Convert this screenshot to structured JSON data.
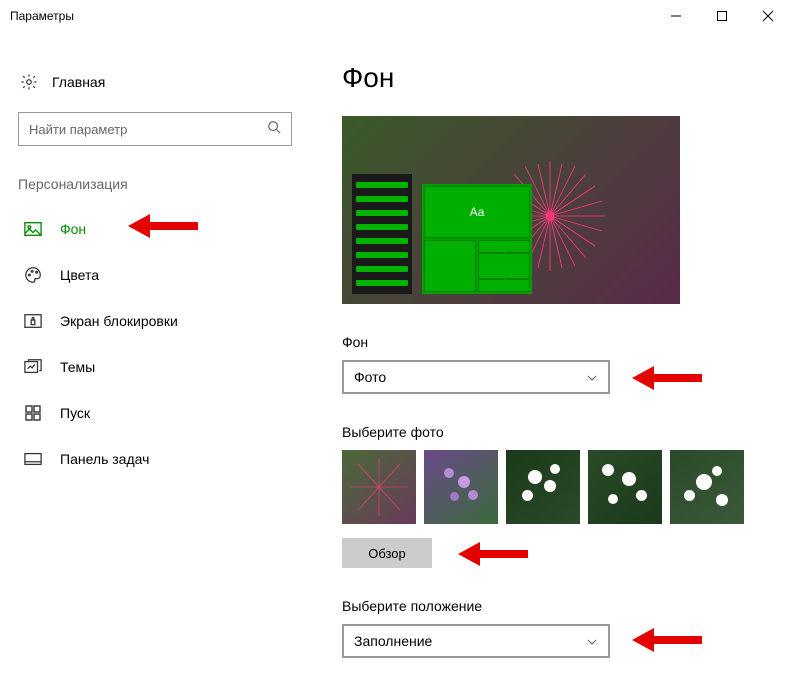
{
  "window": {
    "title": "Параметры"
  },
  "sidebar": {
    "home": "Главная",
    "search_placeholder": "Найти параметр",
    "section": "Персонализация",
    "items": [
      {
        "label": "Фон",
        "icon": "picture-icon",
        "active": true
      },
      {
        "label": "Цвета",
        "icon": "palette-icon"
      },
      {
        "label": "Экран блокировки",
        "icon": "lock-screen-icon"
      },
      {
        "label": "Темы",
        "icon": "themes-icon"
      },
      {
        "label": "Пуск",
        "icon": "start-icon"
      },
      {
        "label": "Панель задач",
        "icon": "taskbar-icon"
      }
    ]
  },
  "main": {
    "heading": "Фон",
    "preview_sample_text": "Aa",
    "background_label": "Фон",
    "background_value": "Фото",
    "choose_photo_label": "Выберите фото",
    "browse_label": "Обзор",
    "fit_label": "Выберите положение",
    "fit_value": "Заполнение"
  },
  "colors": {
    "accent": "#008a00",
    "arrow": "#e30000"
  }
}
